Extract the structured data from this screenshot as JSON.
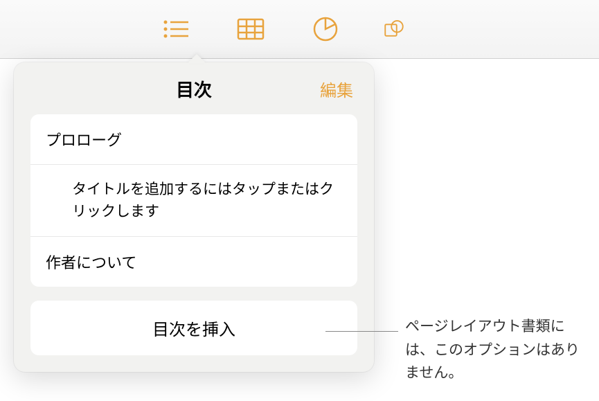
{
  "toolbar": {
    "icons": [
      "list",
      "table",
      "chart",
      "shape"
    ]
  },
  "popover": {
    "title": "目次",
    "edit_label": "編集",
    "toc_items": [
      {
        "label": "プロローグ",
        "indent": false
      },
      {
        "label": "タイトルを追加するにはタップまたはクリックします",
        "indent": true
      },
      {
        "label": "作者について",
        "indent": false
      }
    ],
    "insert_label": "目次を挿入"
  },
  "callout": {
    "text": "ページレイアウト書類には、このオプションはありません。"
  }
}
